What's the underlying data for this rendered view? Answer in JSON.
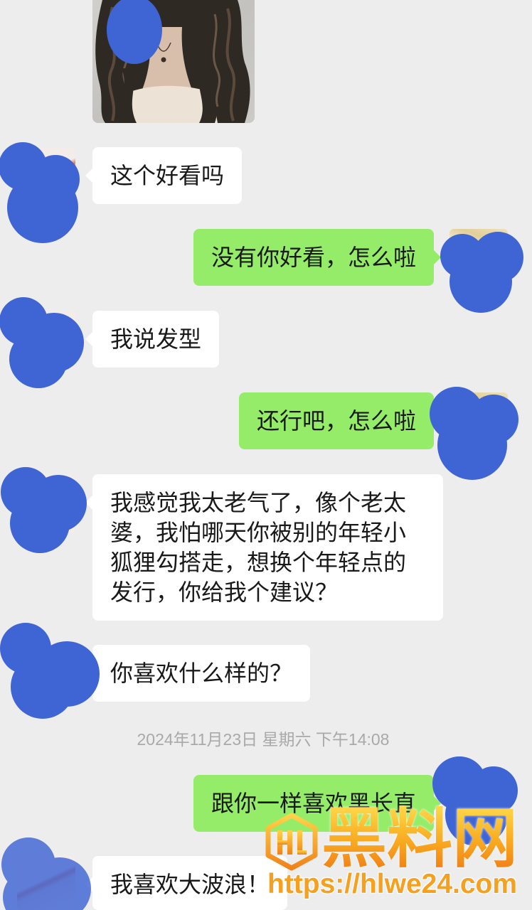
{
  "colors": {
    "background": "#ededed",
    "incoming_bubble": "#ffffff",
    "outgoing_bubble": "#95ec69",
    "text": "#191919",
    "timestamp": "#a9a9a9",
    "redaction": "#3f65d5",
    "watermark": "#f5a01e"
  },
  "conversation": {
    "items": [
      {
        "outgoing": false,
        "is_image": true
      },
      {
        "outgoing": false,
        "text": "这个好看吗"
      },
      {
        "outgoing": true,
        "text": "没有你好看，怎么啦"
      },
      {
        "outgoing": false,
        "text": "我说发型"
      },
      {
        "outgoing": true,
        "text": "还行吧，怎么啦"
      },
      {
        "outgoing": false,
        "text": "我感觉我太老气了，像个老太婆，我怕哪天你被别的年轻小狐狸勾搭走，想换个年轻点的发行，你给我个建议？"
      },
      {
        "outgoing": false,
        "text": "你喜欢什么样的？"
      },
      {
        "time_divider": "2024年11月23日 星期六 下午14:08"
      },
      {
        "outgoing": true,
        "text": "跟你一样喜欢黑长直"
      },
      {
        "outgoing": false,
        "text": "我喜欢大波浪！"
      }
    ]
  },
  "watermark": {
    "logo_icon": "hl-logo-icon",
    "brand": "黑料网",
    "url": "https://hlwe24.com"
  }
}
